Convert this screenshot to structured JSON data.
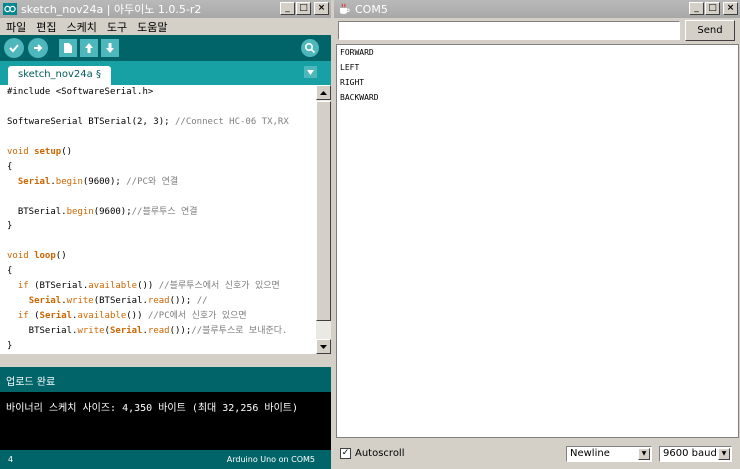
{
  "ide": {
    "title": "sketch_nov24a | 아두이노 1.0.5-r2",
    "menu": [
      "파일",
      "편집",
      "스케치",
      "도구",
      "도움말"
    ],
    "tab_label": "sketch_nov24a §",
    "code": [
      [
        {
          "t": "#include <SoftwareSerial.h>",
          "c": ""
        }
      ],
      [],
      [
        {
          "t": "SoftwareSerial BTSerial(2, 3); ",
          "c": ""
        },
        {
          "t": "//Connect HC-06 TX,RX",
          "c": "cm"
        }
      ],
      [],
      [
        {
          "t": "void ",
          "c": "fn"
        },
        {
          "t": "setup",
          "c": "kw"
        },
        {
          "t": "()",
          "c": ""
        }
      ],
      [
        {
          "t": "{",
          "c": ""
        }
      ],
      [
        {
          "t": "  ",
          "c": ""
        },
        {
          "t": "Serial",
          "c": "kw"
        },
        {
          "t": ".",
          "c": ""
        },
        {
          "t": "begin",
          "c": "fn"
        },
        {
          "t": "(9600); ",
          "c": ""
        },
        {
          "t": "//PC와 연결",
          "c": "cm"
        }
      ],
      [],
      [
        {
          "t": "  BTSerial.",
          "c": ""
        },
        {
          "t": "begin",
          "c": "fn"
        },
        {
          "t": "(9600);",
          "c": ""
        },
        {
          "t": "//블루투스 연결",
          "c": "cm"
        }
      ],
      [
        {
          "t": "}",
          "c": ""
        }
      ],
      [],
      [
        {
          "t": "void ",
          "c": "fn"
        },
        {
          "t": "loop",
          "c": "kw"
        },
        {
          "t": "()",
          "c": ""
        }
      ],
      [
        {
          "t": "{",
          "c": ""
        }
      ],
      [
        {
          "t": "  ",
          "c": ""
        },
        {
          "t": "if",
          "c": "fn"
        },
        {
          "t": " (BTSerial.",
          "c": ""
        },
        {
          "t": "available",
          "c": "fn"
        },
        {
          "t": "()) ",
          "c": ""
        },
        {
          "t": "//블루투스에서 신호가 있으면",
          "c": "cm"
        }
      ],
      [
        {
          "t": "    ",
          "c": ""
        },
        {
          "t": "Serial",
          "c": "kw"
        },
        {
          "t": ".",
          "c": ""
        },
        {
          "t": "write",
          "c": "fn"
        },
        {
          "t": "(BTSerial.",
          "c": ""
        },
        {
          "t": "read",
          "c": "fn"
        },
        {
          "t": "()); ",
          "c": ""
        },
        {
          "t": "//",
          "c": "cm"
        }
      ],
      [
        {
          "t": "  ",
          "c": ""
        },
        {
          "t": "if",
          "c": "fn"
        },
        {
          "t": " (",
          "c": ""
        },
        {
          "t": "Serial",
          "c": "kw"
        },
        {
          "t": ".",
          "c": ""
        },
        {
          "t": "available",
          "c": "fn"
        },
        {
          "t": "()) ",
          "c": ""
        },
        {
          "t": "//PC에서 신호가 있으면",
          "c": "cm"
        }
      ],
      [
        {
          "t": "    BTSerial.",
          "c": ""
        },
        {
          "t": "write",
          "c": "fn"
        },
        {
          "t": "(",
          "c": ""
        },
        {
          "t": "Serial",
          "c": "kw"
        },
        {
          "t": ".",
          "c": ""
        },
        {
          "t": "read",
          "c": "fn"
        },
        {
          "t": "());",
          "c": ""
        },
        {
          "t": "//블루투스로 보내준다.",
          "c": "cm"
        }
      ],
      [
        {
          "t": "}",
          "c": ""
        }
      ]
    ],
    "status": "업로드 완료",
    "console": "바이너리 스케치 사이즈: 4,350 바이트 (최대 32,256 바이트)",
    "line_number": "4",
    "board": "Arduino Uno on COM5",
    "colors": {
      "teal_dark": "#006468",
      "teal_mid": "#17a1a5",
      "teal_button": "#4db7bb",
      "keyword": "#cc6600"
    }
  },
  "serial": {
    "title": "COM5",
    "input_value": "",
    "send_label": "Send",
    "lines": [
      "FORWARD",
      "LEFT",
      "RIGHT",
      "BACKWARD"
    ],
    "autoscroll_label": "Autoscroll",
    "autoscroll_checked": true,
    "line_ending": "Newline",
    "baud": "9600 baud"
  }
}
